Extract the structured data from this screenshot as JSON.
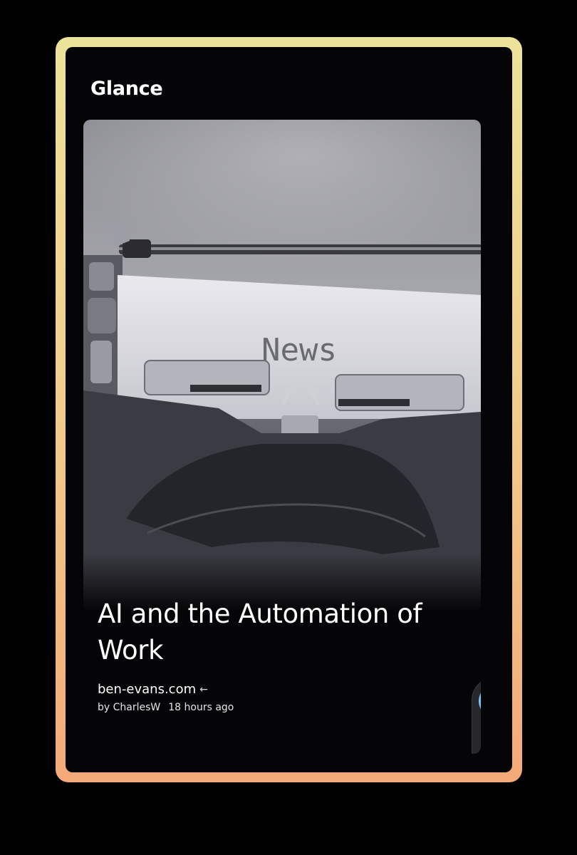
{
  "app": {
    "title": "Glance"
  },
  "card": {
    "image_alt": "Typewriter with a sheet of paper reading News",
    "image_text": "News",
    "title": "AI and the Automation of Work",
    "source": "ben-evans.com",
    "source_icon": "arrow-left-icon",
    "author": "by CharlesW",
    "time": "18 hours ago"
  },
  "nav": {
    "items": [
      {
        "icon": "feed-icon",
        "active": true
      },
      {
        "icon": "article-icon",
        "active": false
      },
      {
        "icon": "profile-icon",
        "active": false
      }
    ],
    "active_color": "#7cc3f2"
  },
  "colors": {
    "frame_top": "#ece39a",
    "frame_bottom": "#f4a978",
    "background": "#050507",
    "text": "#ffffff"
  }
}
